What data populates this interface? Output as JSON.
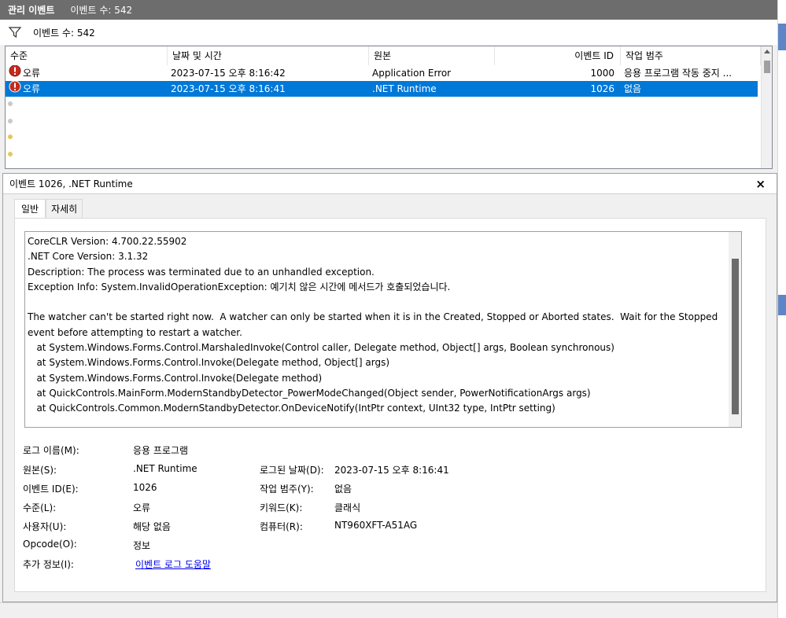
{
  "titlebar": {
    "title": "관리 이벤트",
    "count": "이벤트 수: 542"
  },
  "filterbar": {
    "icon": "filter-icon",
    "label": "이벤트 수: 542"
  },
  "grid": {
    "columns": [
      "수준",
      "날짜 및 시간",
      "원본",
      "이벤트 ID",
      "작업 범주"
    ],
    "rows": [
      {
        "icon": "error-icon",
        "level": "오류",
        "date": "2023-07-15 오후 8:16:42",
        "source": "Application Error",
        "id": "1000",
        "category": "응용 프로그램 작동 중지 ..."
      },
      {
        "icon": "error-icon",
        "level": "오류",
        "date": "2023-07-15 오후 8:16:41",
        "source": ".NET Runtime",
        "id": "1026",
        "category": "없음"
      }
    ]
  },
  "detail": {
    "title": "이벤트 1026, .NET Runtime",
    "close": "×",
    "tabs": [
      "일반",
      "자세히"
    ],
    "description": "CoreCLR Version: 4.700.22.55902\n.NET Core Version: 3.1.32\nDescription: The process was terminated due to an unhandled exception.\nException Info: System.InvalidOperationException: 예기치 않은 시간에 메서드가 호출되었습니다.\n\nThe watcher can't be started right now.  A watcher can only be started when it is in the Created, Stopped or Aborted states.  Wait for the Stopped event before attempting to restart a watcher.\n   at System.Windows.Forms.Control.MarshaledInvoke(Control caller, Delegate method, Object[] args, Boolean synchronous)\n   at System.Windows.Forms.Control.Invoke(Delegate method, Object[] args)\n   at System.Windows.Forms.Control.Invoke(Delegate method)\n   at QuickControls.MainForm.ModernStandbyDetector_PowerModeChanged(Object sender, PowerNotificationArgs args)\n   at QuickControls.Common.ModernStandbyDetector.OnDeviceNotify(IntPtr context, UInt32 type, IntPtr setting)",
    "props": {
      "log_name_label": "로그 이름(M):",
      "log_name": "응용 프로그램",
      "source_label": "원본(S):",
      "source": ".NET Runtime",
      "logged_label": "로그된 날짜(D):",
      "logged": "2023-07-15 오후 8:16:41",
      "event_id_label": "이벤트 ID(E):",
      "event_id": "1026",
      "task_label": "작업 범주(Y):",
      "task": "없음",
      "level_label": "수준(L):",
      "level": "오류",
      "keywords_label": "키워드(K):",
      "keywords": "클래식",
      "user_label": "사용자(U):",
      "user": "해당 없음",
      "computer_label": "컴퓨터(R):",
      "computer": "NT960XFT-A51AG",
      "opcode_label": "Opcode(O):",
      "opcode": "정보",
      "more_label": "추가 정보(I):",
      "more_link": "이벤트 로그 도움말"
    }
  },
  "colors": {
    "titlebar": "#6d6d6d",
    "selection": "#0078d7",
    "link": "#0000ee",
    "error": "#c42b1c"
  }
}
